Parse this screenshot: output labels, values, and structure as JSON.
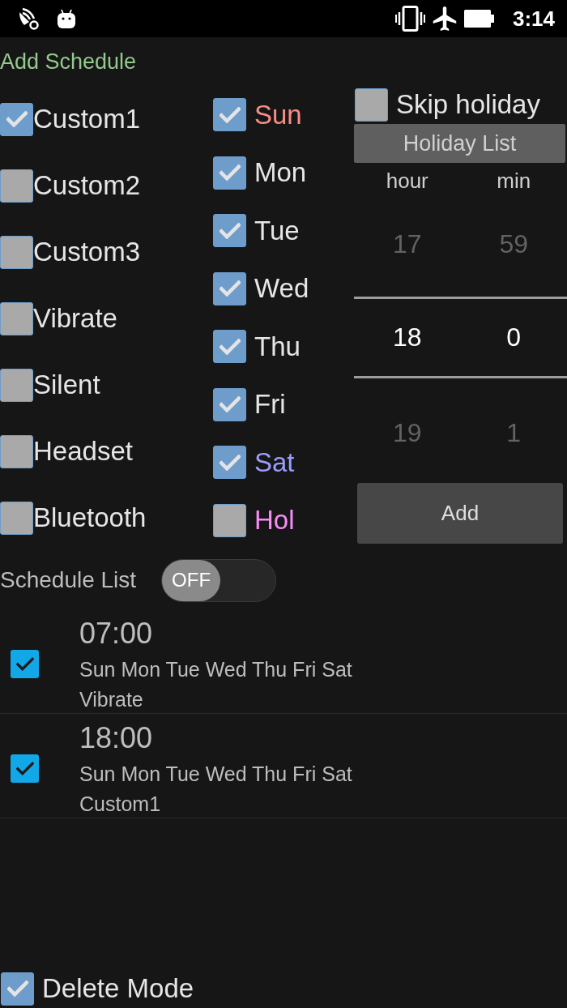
{
  "status_bar": {
    "time": "3:14"
  },
  "title": "Add Schedule",
  "modes": [
    {
      "label": "Custom1",
      "checked": true
    },
    {
      "label": "Custom2",
      "checked": false
    },
    {
      "label": "Custom3",
      "checked": false
    },
    {
      "label": "Vibrate",
      "checked": false
    },
    {
      "label": "Silent",
      "checked": false
    },
    {
      "label": "Headset",
      "checked": false
    },
    {
      "label": "Bluetooth",
      "checked": false
    }
  ],
  "days": [
    {
      "label": "Sun",
      "checked": true,
      "color": "#f78e88"
    },
    {
      "label": "Mon",
      "checked": true,
      "color": "#e6e6e6"
    },
    {
      "label": "Tue",
      "checked": true,
      "color": "#e6e6e6"
    },
    {
      "label": "Wed",
      "checked": true,
      "color": "#e6e6e6"
    },
    {
      "label": "Thu",
      "checked": true,
      "color": "#e6e6e6"
    },
    {
      "label": "Fri",
      "checked": true,
      "color": "#e6e6e6"
    },
    {
      "label": "Sat",
      "checked": true,
      "color": "#9c9cff"
    },
    {
      "label": "Hol",
      "checked": false,
      "color": "#f78cf7"
    }
  ],
  "skip_holiday": {
    "label": "Skip holiday",
    "checked": false
  },
  "holiday_list_button": "Holiday List",
  "time_picker": {
    "columns": [
      {
        "label": "hour",
        "values": [
          {
            "text": "17",
            "selected": false
          },
          {
            "text": "18",
            "selected": true
          },
          {
            "text": "19",
            "selected": false
          }
        ]
      },
      {
        "label": "min",
        "values": [
          {
            "text": "59",
            "selected": false
          },
          {
            "text": "0",
            "selected": true
          },
          {
            "text": "1",
            "selected": false
          }
        ]
      }
    ]
  },
  "add_button": "Add",
  "schedule_list": {
    "label": "Schedule List",
    "toggle": {
      "label": "OFF",
      "on": false
    },
    "items": [
      {
        "time": "07:00",
        "days": "Sun Mon Tue Wed Thu Fri Sat",
        "mode": "Vibrate",
        "checked": true
      },
      {
        "time": "18:00",
        "days": "Sun Mon Tue Wed Thu Fri Sat",
        "mode": "Custom1",
        "checked": true
      }
    ]
  },
  "delete_mode": {
    "label": "Delete Mode",
    "checked": true
  }
}
